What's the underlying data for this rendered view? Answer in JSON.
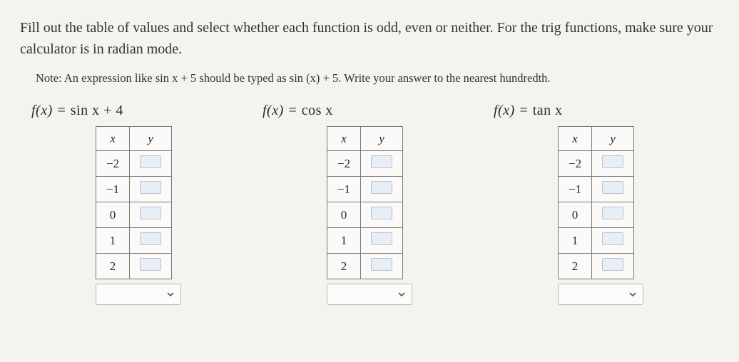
{
  "intro": "Fill out the table of values and select whether each function is odd, even or neither. For the trig functions, make sure your calculator is in radian mode.",
  "note_prefix": "Note: An expression like ",
  "note_expr1": "sin x + 5",
  "note_mid": " should be typed as ",
  "note_expr2": "sin (x) + 5",
  "note_suffix": ". Write your answer to the nearest hundredth.",
  "columns": [
    {
      "fn_lhs": "f(x) = ",
      "fn_rhs": "sin x + 4"
    },
    {
      "fn_lhs": "f(x) = ",
      "fn_rhs": "cos x"
    },
    {
      "fn_lhs": "f(x) = ",
      "fn_rhs": "tan x"
    }
  ],
  "headers": {
    "x": "x",
    "y": "y"
  },
  "x_values": [
    "−2",
    "−1",
    "0",
    "1",
    "2"
  ],
  "chart_data": [
    {
      "type": "table",
      "function": "f(x) = sin x + 4",
      "columns": [
        "x",
        "y"
      ],
      "rows": [
        {
          "x": -2,
          "y": null
        },
        {
          "x": -1,
          "y": null
        },
        {
          "x": 0,
          "y": null
        },
        {
          "x": 1,
          "y": null
        },
        {
          "x": 2,
          "y": null
        }
      ],
      "classification": null
    },
    {
      "type": "table",
      "function": "f(x) = cos x",
      "columns": [
        "x",
        "y"
      ],
      "rows": [
        {
          "x": -2,
          "y": null
        },
        {
          "x": -1,
          "y": null
        },
        {
          "x": 0,
          "y": null
        },
        {
          "x": 1,
          "y": null
        },
        {
          "x": 2,
          "y": null
        }
      ],
      "classification": null
    },
    {
      "type": "table",
      "function": "f(x) = tan x",
      "columns": [
        "x",
        "y"
      ],
      "rows": [
        {
          "x": -2,
          "y": null
        },
        {
          "x": -1,
          "y": null
        },
        {
          "x": 0,
          "y": null
        },
        {
          "x": 1,
          "y": null
        },
        {
          "x": 2,
          "y": null
        }
      ],
      "classification": null
    }
  ]
}
